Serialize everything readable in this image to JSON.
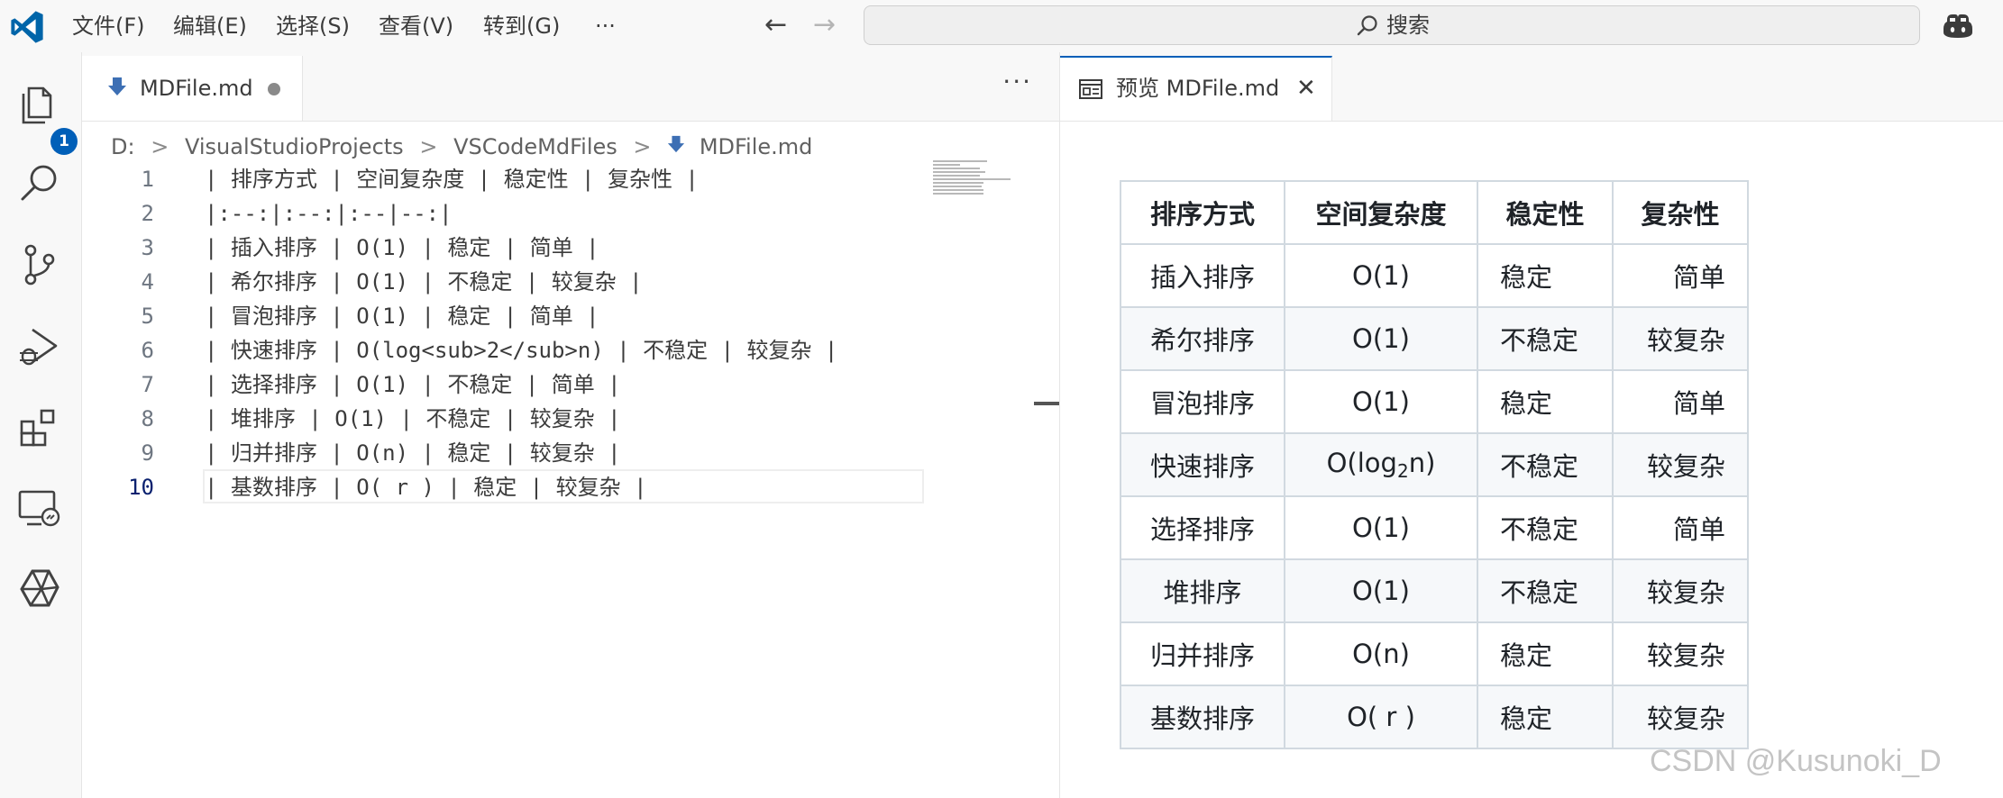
{
  "menu": [
    "文件(F)",
    "编辑(E)",
    "选择(S)",
    "查看(V)",
    "转到(G)",
    "···"
  ],
  "search": {
    "label": "搜索"
  },
  "explorer_badge": "1",
  "editor": {
    "tab_title": "MDFile.md",
    "more": "···",
    "breadcrumb": [
      "D:",
      "VisualStudioProjects",
      "VSCodeMdFiles",
      "MDFile.md"
    ],
    "lines": [
      {
        "num": "1",
        "text": "| 排序方式 | 空间复杂度 | 稳定性 | 复杂性 |"
      },
      {
        "num": "2",
        "text": "|:--:|:--:|:--|--:|"
      },
      {
        "num": "3",
        "text": "| 插入排序 | O(1) | 稳定 | 简单 |"
      },
      {
        "num": "4",
        "text": "| 希尔排序 | O(1) | 不稳定 | 较复杂 |"
      },
      {
        "num": "5",
        "text": "| 冒泡排序 | O(1) | 稳定 | 简单 |"
      },
      {
        "num": "6",
        "text": "| 快速排序 | O(log<sub>2</sub>n) | 不稳定 | 较复杂 |"
      },
      {
        "num": "7",
        "text": "| 选择排序 | O(1) | 不稳定 | 简单 |"
      },
      {
        "num": "8",
        "text": "| 堆排序 | O(1) | 不稳定 | 较复杂 |"
      },
      {
        "num": "9",
        "text": "| 归并排序 | O(n) | 稳定 | 较复杂 |"
      },
      {
        "num": "10",
        "text": "| 基数排序 | O( r ) | 稳定 | 较复杂 |"
      }
    ]
  },
  "preview": {
    "tab_title": "预览 MDFile.md",
    "close": "✕",
    "table": {
      "headers": [
        "排序方式",
        "空间复杂度",
        "稳定性",
        "复杂性"
      ],
      "rows": [
        [
          "插入排序",
          "O(1)",
          "稳定",
          "简单"
        ],
        [
          "希尔排序",
          "O(1)",
          "不稳定",
          "较复杂"
        ],
        [
          "冒泡排序",
          "O(1)",
          "稳定",
          "简单"
        ],
        [
          "快速排序",
          "O(log",
          "不稳定",
          "较复杂"
        ],
        [
          "选择排序",
          "O(1)",
          "不稳定",
          "简单"
        ],
        [
          "堆排序",
          "O(1)",
          "不稳定",
          "较复杂"
        ],
        [
          "归并排序",
          "O(n)",
          "稳定",
          "较复杂"
        ],
        [
          "基数排序",
          "O( r )",
          "稳定",
          "较复杂"
        ]
      ],
      "log_sub": "2",
      "log_tail": "n)"
    }
  },
  "watermark": "CSDN @Kusunoki_D",
  "colors": {
    "accent": "#005fb8",
    "vscode_blue": "#0065a9"
  }
}
